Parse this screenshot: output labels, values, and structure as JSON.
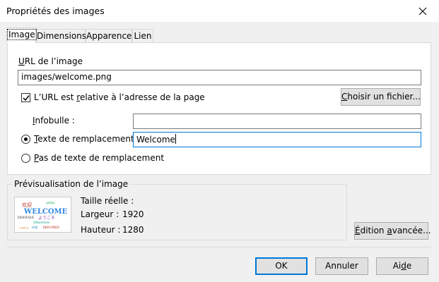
{
  "window": {
    "title": "Propriétés des images"
  },
  "tabs": [
    {
      "label": "Image",
      "active": true
    },
    {
      "label": "Dimensions",
      "active": false
    },
    {
      "label": "Apparence",
      "active": false
    },
    {
      "label": "Lien",
      "active": false
    }
  ],
  "image_tab": {
    "url_label_u": "U",
    "url_label_rest": "RL de l’image",
    "url_value": "images/welcome.png",
    "relative_pre": "L’URL est ",
    "relative_u": "r",
    "relative_post": "elative à l’adresse de la page",
    "relative_checked": true,
    "choose_file_u": "C",
    "choose_file_rest": "hoisir un fichier...",
    "tooltip_u": "I",
    "tooltip_rest": "nfobulle :",
    "tooltip_value": "",
    "alt_u": "T",
    "alt_rest": "exte de remplacement :",
    "alt_value": "Welcome",
    "no_alt_u": "P",
    "no_alt_rest": "as de texte de remplacement",
    "alt_selected": true
  },
  "preview": {
    "title": "Prévisualisation de l’image",
    "actual_size_label": "Taille réelle :",
    "width_label": "Largeur :",
    "width_value": "1920",
    "height_label": "Hauteur :",
    "height_value": "1280",
    "advanced_u": "É",
    "advanced_mid": "dition ",
    "advanced_u2": "a",
    "advanced_rest": "vancée...",
    "thumb_words": {
      "w1": "欢迎",
      "w2": "WELCOME",
      "w3": "BIENVENUE",
      "w4": "ようこそ",
      "w5": "Välkommen",
      "w6": "BEM-VINDO",
      "w7": "ترحيب",
      "w8": "环境",
      "w9": "добро"
    }
  },
  "footer": {
    "ok_label": "OK",
    "cancel_label": "Annuler",
    "help_pre": "Ai",
    "help_u": "d",
    "help_rest": "e"
  },
  "colors": {
    "accent": "#0078d7",
    "background": "#f0f0f0"
  }
}
